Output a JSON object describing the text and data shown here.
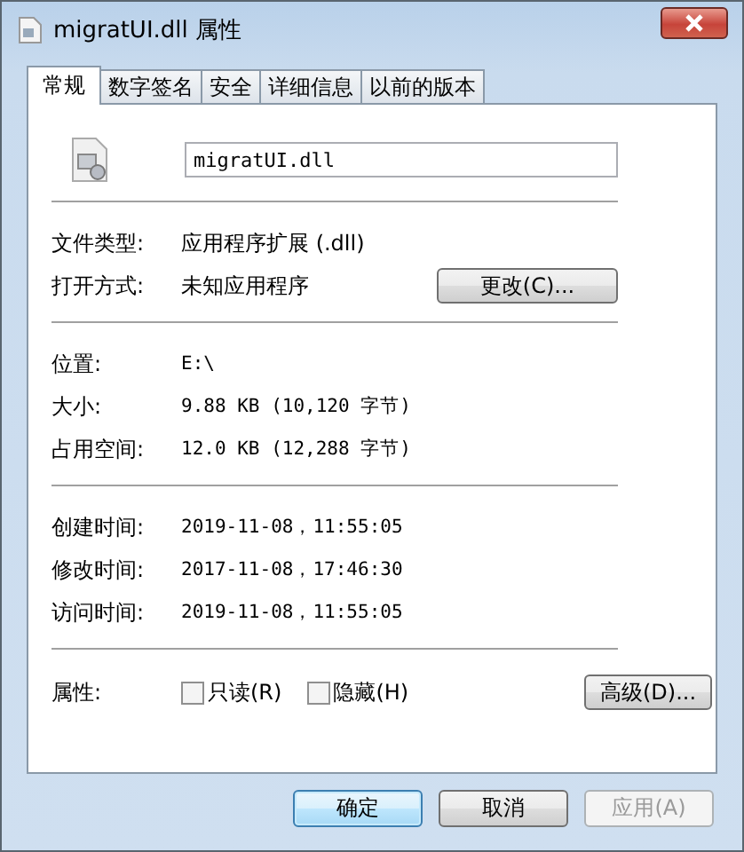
{
  "window": {
    "title": "migratUI.dll 属性"
  },
  "tabs": [
    {
      "label": "常规",
      "selected": true
    },
    {
      "label": "数字签名",
      "selected": false
    },
    {
      "label": "安全",
      "selected": false
    },
    {
      "label": "详细信息",
      "selected": false
    },
    {
      "label": "以前的版本",
      "selected": false
    }
  ],
  "file_name": "migratUI.dll",
  "groups": [
    [
      {
        "label": "文件类型:",
        "value": "应用程序扩展 (.dll)"
      },
      {
        "label": "打开方式:",
        "value": "未知应用程序",
        "button": "更改(C)..."
      }
    ],
    [
      {
        "label": "位置:",
        "value": "E:\\"
      },
      {
        "label": "大小:",
        "value": "9.88 KB (10,120 字节)"
      },
      {
        "label": "占用空间:",
        "value": "12.0 KB (12,288 字节)"
      }
    ],
    [
      {
        "label": "创建时间:",
        "value": "2019-11-08，11:55:05"
      },
      {
        "label": "修改时间:",
        "value": "2017-11-08，17:46:30"
      },
      {
        "label": "访问时间:",
        "value": "2019-11-08，11:55:05"
      }
    ]
  ],
  "attributes": {
    "label": "属性:",
    "checkboxes": [
      {
        "label": "只读(R)",
        "checked": false
      },
      {
        "label": "隐藏(H)",
        "checked": false
      }
    ],
    "button": "高级(D)..."
  },
  "buttons": [
    {
      "label": "确定",
      "default": true,
      "disabled": false
    },
    {
      "label": "取消",
      "default": false,
      "disabled": false
    },
    {
      "label": "应用(A)",
      "default": false,
      "disabled": true
    }
  ]
}
